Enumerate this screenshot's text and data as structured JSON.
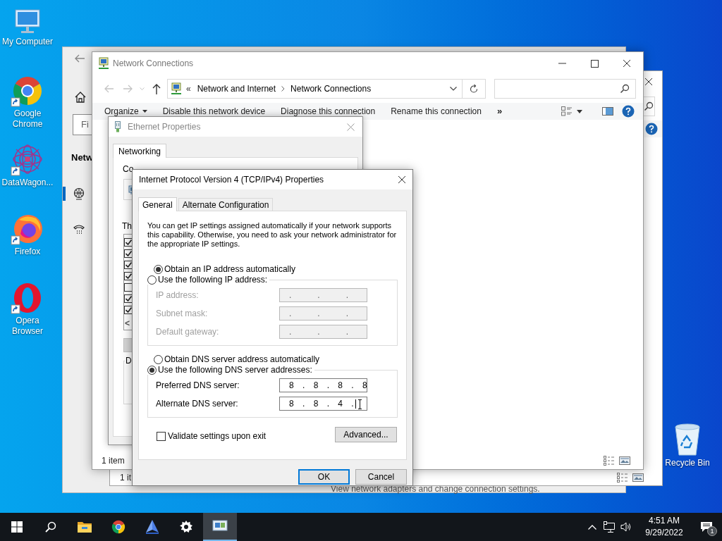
{
  "desktop_icons": [
    {
      "kind": "computer",
      "label": "My Computer"
    },
    {
      "kind": "chrome",
      "label": "Google Chrome"
    },
    {
      "kind": "datawagon",
      "label": "DataWagon..."
    },
    {
      "kind": "firefox",
      "label": "Firefox"
    },
    {
      "kind": "opera",
      "label": "Opera Browser"
    }
  ],
  "recycle_bin": {
    "label": "Recycle Bin"
  },
  "settings_window": {
    "search_placeholder": "Fi",
    "heading": "Netw",
    "nav": [
      {
        "kind": "ethernet",
        "selected": true
      },
      {
        "kind": "dialup",
        "selected": false
      }
    ],
    "footer": "View network adapters and change connection settings."
  },
  "explorer_back": {
    "status": "1 it"
  },
  "explorer": {
    "title": "Network Connections",
    "overflow": "«",
    "breadcrumb": [
      "Network and Internet",
      "Network Connections"
    ],
    "toolbar": [
      {
        "label": "Organize",
        "kind": "menu"
      },
      {
        "label": "Disable this network device",
        "kind": "command"
      },
      {
        "label": "Diagnose this connection",
        "kind": "command"
      },
      {
        "label": "Rename this connection",
        "kind": "command"
      }
    ],
    "more": "»",
    "status": "1 item"
  },
  "ethernet": {
    "title": "Ethernet Properties",
    "tabs": [
      {
        "label": "Networking",
        "selected": true
      }
    ],
    "connect_label": "Co",
    "components_label": "Th",
    "components": [
      {
        "checked": true
      },
      {
        "checked": true
      },
      {
        "checked": true
      },
      {
        "checked": true
      },
      {
        "checked": false
      },
      {
        "checked": true
      },
      {
        "checked": true
      }
    ],
    "scroll": "<",
    "description_label": "D"
  },
  "ipv4": {
    "title": "Internet Protocol Version 4 (TCP/IPv4) Properties",
    "tabs": [
      {
        "label": "General",
        "selected": true
      },
      {
        "label": "Alternate Configuration",
        "selected": false
      }
    ],
    "intro": "You can get IP settings assigned automatically if your network supports this capability. Otherwise, you need to ask your network administrator for the appropriate IP settings.",
    "ip_mode": [
      {
        "label": "Obtain an IP address automatically",
        "selected": true
      },
      {
        "label": "Use the following IP address:",
        "selected": false
      }
    ],
    "ip_fields": [
      {
        "label": "IP address:",
        "value": ".   .   .",
        "disabled": true
      },
      {
        "label": "Subnet mask:",
        "value": ".   .   .",
        "disabled": true
      },
      {
        "label": "Default gateway:",
        "value": ".   .   .",
        "disabled": true
      }
    ],
    "dns_mode": [
      {
        "label": "Obtain DNS server address automatically",
        "selected": false
      },
      {
        "label": "Use the following DNS server addresses:",
        "selected": true
      }
    ],
    "dns_fields": [
      {
        "label": "Preferred DNS server:",
        "value": "8 . 8 . 8 . 8",
        "disabled": false,
        "focused": false
      },
      {
        "label": "Alternate DNS server:",
        "value": "8 . 8 . 4 .",
        "disabled": false,
        "focused": true
      }
    ],
    "validate": {
      "label": "Validate settings upon exit",
      "checked": false
    },
    "advanced": "Advanced...",
    "buttons": [
      {
        "label": "OK",
        "default": true
      },
      {
        "label": "Cancel",
        "default": false
      }
    ]
  },
  "taskbar": {
    "apps": [
      {
        "kind": "start",
        "selected": false
      },
      {
        "kind": "search",
        "selected": false
      },
      {
        "kind": "explorer",
        "selected": false
      },
      {
        "kind": "chrome",
        "selected": false
      },
      {
        "kind": "sail",
        "selected": false
      },
      {
        "kind": "settings",
        "selected": false
      },
      {
        "kind": "network",
        "selected": true
      }
    ],
    "time": "4:51 AM",
    "date": "9/29/2022",
    "notifications": "1"
  }
}
